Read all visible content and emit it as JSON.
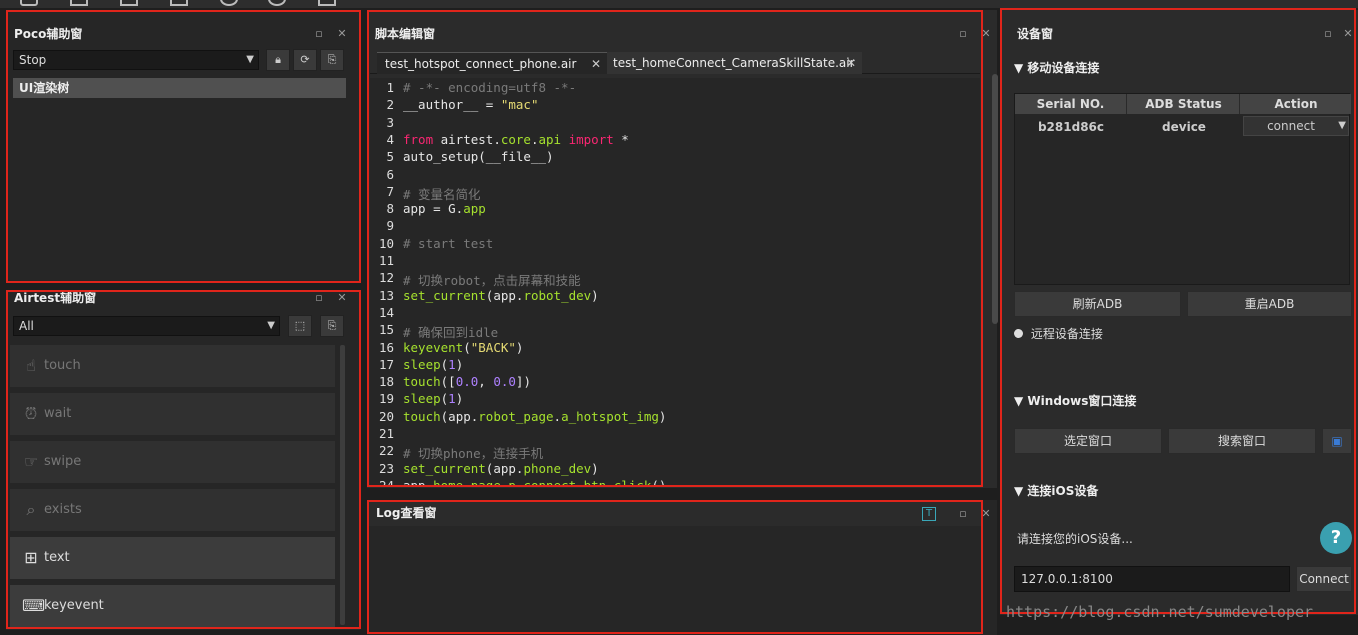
{
  "toolbar_top": {
    "icons": [
      "add-icon",
      "copy-icon",
      "save-icon",
      "save-as-icon",
      "record-icon",
      "replay-icon",
      "window-icon"
    ]
  },
  "poco": {
    "title": "Poco辅助窗",
    "mode": "Stop",
    "tree_label": "UI渲染树"
  },
  "airtest": {
    "title": "Airtest辅助窗",
    "filter": "All",
    "items": [
      {
        "label": "touch",
        "icon": "hand-icon",
        "active": false
      },
      {
        "label": "wait",
        "icon": "clock-icon",
        "active": false
      },
      {
        "label": "swipe",
        "icon": "swipe-icon",
        "active": false
      },
      {
        "label": "exists",
        "icon": "search-check-icon",
        "active": false
      },
      {
        "label": "text",
        "icon": "text-icon",
        "active": true
      },
      {
        "label": "keyevent",
        "icon": "keyboard-icon",
        "active": true
      }
    ]
  },
  "editor": {
    "title": "脚本编辑窗",
    "tabs": [
      "test_hotspot_connect_phone.air",
      "test_homeConnect_CameraSkillState.air"
    ],
    "lines": [
      {
        "n": "1",
        "html": "<span class='cm'># -*- encoding=utf8 -*-</span>"
      },
      {
        "n": "2",
        "html": "__author__ = <span class='st'>\"mac\"</span>"
      },
      {
        "n": "3",
        "html": ""
      },
      {
        "n": "4",
        "html": "<span class='kw'>from</span> airtest.<span class='fn'>core</span>.<span class='fn'>api</span> <span class='kw'>import</span> *"
      },
      {
        "n": "5",
        "html": "auto_setup(__file__)"
      },
      {
        "n": "6",
        "html": ""
      },
      {
        "n": "7",
        "html": "<span class='cm'># 变量名简化</span>"
      },
      {
        "n": "8",
        "html": "app = G.<span class='fn'>app</span>"
      },
      {
        "n": "9",
        "html": ""
      },
      {
        "n": "10",
        "html": "<span class='cm'># start test</span>"
      },
      {
        "n": "11",
        "html": ""
      },
      {
        "n": "12",
        "html": "<span class='cm'># 切换robot，点击屏幕和技能</span>"
      },
      {
        "n": "13",
        "html": "<span class='fn'>set_current</span>(app.<span class='fn'>robot_dev</span>)"
      },
      {
        "n": "14",
        "html": ""
      },
      {
        "n": "15",
        "html": "<span class='cm'># 确保回到idle</span>"
      },
      {
        "n": "16",
        "html": "<span class='fn'>keyevent</span>(<span class='st'>\"BACK\"</span>)"
      },
      {
        "n": "17",
        "html": "<span class='fn'>sleep</span>(<span class='nu'>1</span>)"
      },
      {
        "n": "18",
        "html": "<span class='fn'>touch</span>([<span class='nu'>0.0</span>, <span class='nu'>0.0</span>])"
      },
      {
        "n": "19",
        "html": "<span class='fn'>sleep</span>(<span class='nu'>1</span>)"
      },
      {
        "n": "20",
        "html": "<span class='fn'>touch</span>(app.<span class='fn'>robot_page</span>.<span class='fn'>a_hotspot_img</span>)"
      },
      {
        "n": "21",
        "html": ""
      },
      {
        "n": "22",
        "html": "<span class='cm'># 切换phone，连接手机</span>"
      },
      {
        "n": "23",
        "html": "<span class='fn'>set_current</span>(app.<span class='fn'>phone_dev</span>)"
      },
      {
        "n": "24",
        "html": "app.<span class='fn'>home_page</span>.<span class='fn'>p_connect_btn_click</span>()"
      }
    ]
  },
  "log": {
    "title": "Log查看窗"
  },
  "device": {
    "title": "设备窗",
    "mobile_section": "移动设备连接",
    "table_headers": [
      "Serial NO.",
      "ADB Status",
      "Action"
    ],
    "rows": [
      {
        "serial": "b281d86c",
        "status": "device",
        "action": "connect"
      }
    ],
    "refresh_adb": "刷新ADB",
    "restart_adb": "重启ADB",
    "remote": "远程设备连接",
    "windows_section": "Windows窗口连接",
    "select_window": "选定窗口",
    "search_window": "搜索窗口",
    "ios_section": "连接iOS设备",
    "ios_prompt": "请连接您的iOS设备...",
    "ios_address": "127.0.0.1:8100",
    "ios_connect": "Connect",
    "help": "?"
  },
  "watermark": "https://blog.csdn.net/sumdeveloper"
}
